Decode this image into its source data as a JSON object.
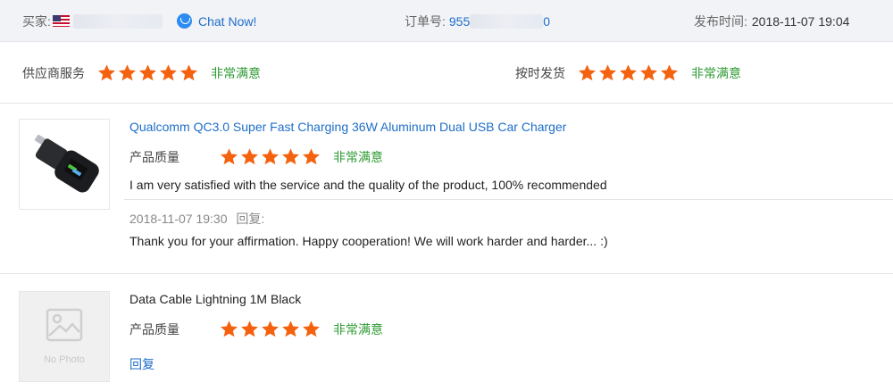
{
  "header": {
    "buyer_label": "买家:",
    "chat_label": "Chat Now!",
    "order_label": "订单号:",
    "order_number_visible": "955",
    "order_number_tail": "0",
    "publish_label": "发布时间:",
    "publish_time": "2018-11-07 19:04"
  },
  "seller_ratings": [
    {
      "label": "供应商服务",
      "stars": 5,
      "satisfaction": "非常满意"
    },
    {
      "label": "按时发货",
      "stars": 5,
      "satisfaction": "非常满意"
    }
  ],
  "products": [
    {
      "title": "Qualcomm QC3.0 Super Fast Charging 36W Aluminum Dual USB Car Charger",
      "quality_label": "产品质量",
      "stars": 5,
      "satisfaction": "非常满意",
      "comment": "I am very satisfied with the service and the quality of the product, 100% recommended",
      "reply_time": "2018-11-07 19:30",
      "reply_label": "回复:",
      "reply_text": "Thank you for your affirmation. Happy cooperation! We will work harder and harder... :)"
    },
    {
      "title": "Data Cable Lightning 1M Black",
      "no_photo": "No Photo",
      "quality_label": "产品质量",
      "stars": 5,
      "satisfaction": "非常满意",
      "reply_link": "回复"
    }
  ],
  "colors": {
    "star": "#f5620f",
    "satisfied": "#2e9b33",
    "link": "#1e6ec8"
  }
}
